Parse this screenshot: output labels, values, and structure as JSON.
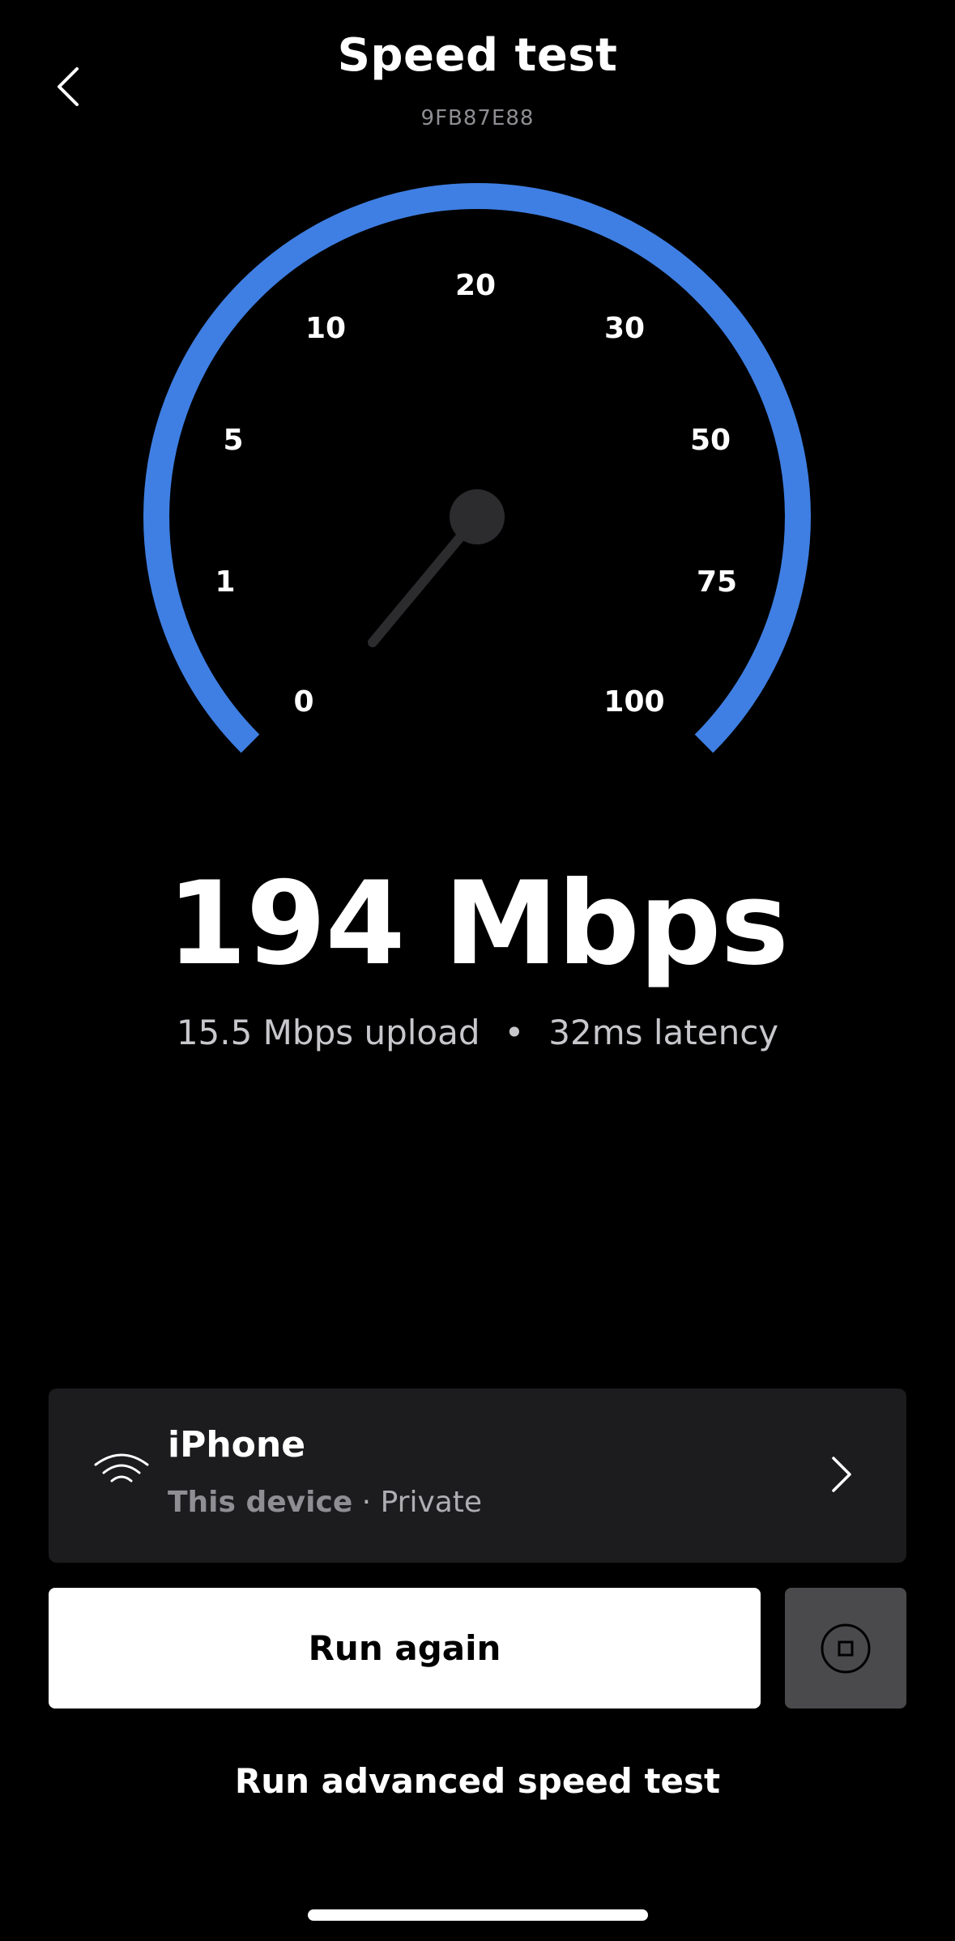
{
  "header": {
    "title": "Speed test",
    "device_id": "9FB87E88"
  },
  "gauge": {
    "tick_labels": [
      "0",
      "1",
      "5",
      "10",
      "20",
      "30",
      "50",
      "75",
      "100"
    ],
    "needle_value": "0",
    "arc_color": "#3f7fe3"
  },
  "result": {
    "download": "194 Mbps",
    "upload": "15.5 Mbps upload",
    "separator": "•",
    "latency": "32ms latency"
  },
  "device": {
    "name": "iPhone",
    "subtitle_bold": "This device",
    "subtitle_rest": " · Private",
    "icon": "wifi-icon"
  },
  "actions": {
    "run_again": "Run again",
    "stop_icon": "stop-icon",
    "advanced": "Run advanced speed test"
  },
  "colors": {
    "background": "#000000",
    "accent": "#3f7fe3",
    "card": "#1c1c1e"
  }
}
